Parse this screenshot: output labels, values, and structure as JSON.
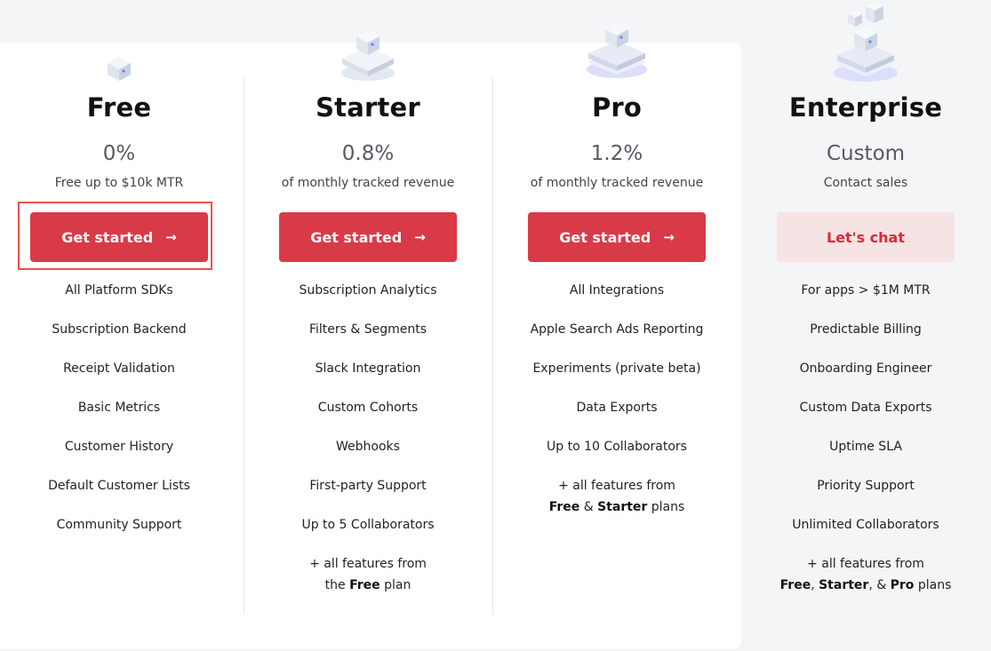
{
  "plans": [
    {
      "name": "Free",
      "price": "0%",
      "subtitle": "Free up to $10k MTR",
      "cta_label": "Get started",
      "cta_style": "primary",
      "icon": "small-cube-icon",
      "features": [
        "All Platform SDKs",
        "Subscription Backend",
        "Receipt Validation",
        "Basic Metrics",
        "Customer History",
        "Default Customer Lists",
        "Community Support"
      ]
    },
    {
      "name": "Starter",
      "price": "0.8%",
      "subtitle": "of monthly tracked revenue",
      "cta_label": "Get started",
      "cta_style": "primary",
      "icon": "cube-on-platform-icon",
      "features": [
        "Subscription Analytics",
        "Filters & Segments",
        "Slack Integration",
        "Custom Cohorts",
        "Webhooks",
        "First-party Support",
        "Up to 5 Collaborators"
      ],
      "extra_line1": "+ all features from",
      "extra_line2_pre": "the ",
      "extra_line2_bold": "Free",
      "extra_line2_post": " plan"
    },
    {
      "name": "Pro",
      "price": "1.2%",
      "subtitle": "of monthly tracked revenue",
      "cta_label": "Get started",
      "cta_style": "primary",
      "icon": "cube-on-stacked-platform-icon",
      "features": [
        "All Integrations",
        "Apple Search Ads Reporting",
        "Experiments (private beta)",
        "Data Exports",
        "Up to 10 Collaborators"
      ],
      "extra_line1": "+ all features from",
      "extra_bold1": "Free",
      "extra_sep1": " & ",
      "extra_bold2": "Starter",
      "extra_post": " plans"
    },
    {
      "name": "Enterprise",
      "price": "Custom",
      "subtitle": "Contact sales",
      "cta_label": "Let's chat",
      "cta_style": "soft",
      "icon": "stacked-cubes-tower-icon",
      "features": [
        "For apps > $1M MTR",
        "Predictable Billing",
        "Onboarding Engineer",
        "Custom Data Exports",
        "Uptime SLA",
        "Priority Support",
        "Unlimited Collaborators"
      ],
      "extra_line1": "+ all features from",
      "extra_bold1": "Free",
      "extra_sep1": ", ",
      "extra_bold2": "Starter",
      "extra_sep2": ", & ",
      "extra_bold3": "Pro",
      "extra_post": " plans"
    }
  ],
  "arrow": "→",
  "colors": {
    "primary": "#d93a47",
    "soft_bg": "#f6e3e4",
    "soft_text": "#d52b3b",
    "highlight": "#ee4f4a",
    "page_bg": "#f4f5f7"
  }
}
